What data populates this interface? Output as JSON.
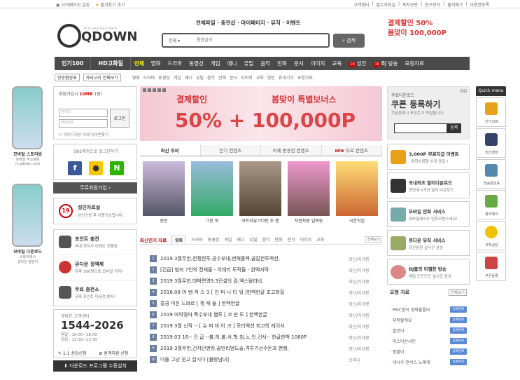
{
  "topbar": {
    "left": [
      "시작페이지 설정",
      "즐겨찾기 추가"
    ],
    "right": [
      "고객센터",
      "필수자료실",
      "독자공란",
      "친구관리",
      "출석체크",
      "이용권등록"
    ]
  },
  "logo": {
    "text": "QDOWN",
    "tagline": "PC와 모바일 모두가 함께 큐"
  },
  "toplinks": "전체파일 · 충전샵 · 마이페이지 · 뮤직 · 이벤트",
  "search": {
    "select": "전체",
    "placeholder": "통합검색",
    "button": "검색"
  },
  "topbanner": {
    "l1": "결제할인 50%",
    "l2": "봄맞이 100,000P"
  },
  "gnb": {
    "big1": "인기100",
    "big2": "HD고화질",
    "items": [
      "전체",
      "영화",
      "드라마",
      "동영상",
      "게임",
      "애니",
      "유틸",
      "음악",
      "만화",
      "문서",
      "이미지",
      "교육",
      "성인",
      "BJ 방송",
      "요청자료"
    ],
    "badge": "19"
  },
  "subnav": {
    "btn1": "방송편성표",
    "btn2": "카테고리 전체보기",
    "items": [
      "영화",
      "드라마",
      "동영상",
      "게임",
      "애니",
      "유틸",
      "음악",
      "만화",
      "문서",
      "이미지",
      "교육",
      "성인",
      "휴대기기",
      "요청자료"
    ]
  },
  "mobile1": {
    "t1": "모바일 스토리빙",
    "t2": "모바일 주소창에",
    "t3": "m.qdown.com"
  },
  "mobile2": {
    "t1": "모바일 다운로드",
    "t2": "스토어에서",
    "t3": "큐다운 앱검지"
  },
  "login": {
    "note_pre": "회원가입시",
    "note_bold": "10MB",
    "note_post": "1원!",
    "id": "아이디",
    "pw": "비밀번호",
    "btn": "로그인",
    "chk": "아이디저장  아이디/비번찾기"
  },
  "sns": {
    "title": "SNS계정으로 로그인하기"
  },
  "join": "무료회원가입 ›",
  "adult": {
    "badge": "19",
    "a": "성인자료실",
    "b": "성인인증 후 이용가능합니다."
  },
  "svc": [
    {
      "a": "포인트 충전",
      "b": "국내 최저가 이벤트 진행중"
    },
    {
      "a": "큐다운 정액제",
      "b": "하루 300원으로 모바일 까지?"
    },
    {
      "a": "무료 충전소",
      "b": "공짜 포인트 마음껏 받자!"
    }
  ],
  "cs": {
    "label": "큐다운 고객센터",
    "phone": "1544-2026",
    "hours1": "평일 : 10:00~18:00",
    "hours2": "점심 : 12:30~13:30",
    "b1": "1:1 상담신청",
    "b2": "원격지원 신청"
  },
  "dlbtn": "다운로드 프로그램 수동설치",
  "mainbanner": {
    "h1": "결제할인",
    "h2": "봄맞이 특별보너스",
    "big": "50%  +  100,000P"
  },
  "tabs": {
    "t1": "최신 무비",
    "t2": "인기 컨텐츠",
    "t3": "어제 방송한 컨텐츠",
    "new": "NEW",
    "t4": "무료 컨텐츠"
  },
  "posters": [
    "증인",
    "그린 북",
    "어트리뷰스타틴 투 맨",
    "자전차왕 엄복동",
    "극한직업"
  ],
  "ranktabs": {
    "title": "최신인기 자료",
    "items": [
      "영화",
      "드라마",
      "동영상",
      "게임",
      "애니",
      "유틸",
      "음악",
      "만화",
      "문서",
      "이미지",
      "교육"
    ],
    "more": "전체보기"
  },
  "ranklist": [
    {
      "n": "1",
      "t": "2019 3월무한,전쟁전투,공수부대,변해플렉,골잡전투액션,",
      "c": "최신/미개봉"
    },
    {
      "n": "2",
      "t": "[긴급] 범죄 7인의 전체들 - 이태리 도적들 - 완액자막",
      "c": "최신/미개봉"
    },
    {
      "n": "3",
      "t": "2019 3월무한,대박편영9.3전설의 감,엑스탐라비,",
      "c": "최신/미개봉"
    },
    {
      "n": "4",
      "t": "2018.08 어 벤 져 스 3 [ 인 피 니 티 워 ]한백한글 초고화질",
      "c": "최신/미개봉"
    },
    {
      "n": "5",
      "t": "흥콩 미친 느와르 [ 쟁 패 들 ] 한백한글",
      "c": "최신/미개봉"
    },
    {
      "n": "6",
      "t": "2019 마약경파 특수부대 챔투 [ 코 만 도 ] 한백한글",
      "c": "최신/미개봉"
    },
    {
      "n": "7",
      "t": "2019 3월 신작 -- [ 슈 퍼 바 이 크 ] 모터액션 최고의 레이서",
      "c": "최신/미개봉"
    },
    {
      "n": "8",
      "t": "2019.03 16-- 건 급 --불.허.불.사.혁.침,노.인.건사-- 한글한백 1080P",
      "c": "최신/미개봉"
    },
    {
      "n": "9",
      "t": "2019 3월무한,건자던맨땅,끝만리범도술,격투기선수돈과 팬행,",
      "c": "최신/미개봉"
    },
    {
      "n": "10",
      "t": "다들 그냥 웃고 삽시다 [볼랑남녀]",
      "c": "코미디"
    }
  ],
  "coupon": {
    "a": "무료다운로드",
    "b": "쿠폰 등록하기",
    "c": "쿠폰등록시 포인트가 적립됩니다.",
    "btn": "등록",
    "go": "GO"
  },
  "promos": [
    {
      "a": "3,000P 무료지급 이벤트",
      "b": "· 편하싱콤형 수검 응답 !",
      "col": "#e8a21a"
    },
    {
      "a": "국내최초 멀티다운로드",
      "b": "한번에 5개의 멀티 다운로드",
      "col": "#333"
    },
    {
      "a": "모바일 만화 서비스",
      "b": "모바일에서도 만화보면드세요!",
      "col": "#7aa"
    },
    {
      "a": "큐다운 뮤직 서비스",
      "b": "최신음원 실시간 감상",
      "col": "#9a6"
    },
    {
      "a": "BJ들의 아찔한 방송",
      "b": "매일 뜨끈뜨끈 실시간 감상",
      "col": "#d88"
    }
  ],
  "req": {
    "title": "요청 자료",
    "more": "전체보기",
    "items": [
      "PMC범어 영화출플라",
      "부탁할게요",
      "발만이",
      "미스터선샤인",
      "범볼이",
      "데사우 댄서스 노제캐"
    ],
    "badge": "등록완료"
  },
  "quick": {
    "head": "Quick menu",
    "items": [
      {
        "t": "인기100",
        "col": "#e8a21a"
      },
      {
        "t": "최신영화",
        "col": "#346"
      },
      {
        "t": "방송편성표",
        "col": "#58a"
      },
      {
        "t": "출석체크",
        "col": "#6a4"
      },
      {
        "t": "카톡상담",
        "col": "#f2c200"
      },
      {
        "t": "쿠폰등록",
        "col": "#c44"
      }
    ]
  },
  "colors": {
    "gnb": "#4a4a4a",
    "accent": "#d33",
    "rank_num": "#6a7d9a",
    "badge_blue": "#5a8ad6"
  }
}
